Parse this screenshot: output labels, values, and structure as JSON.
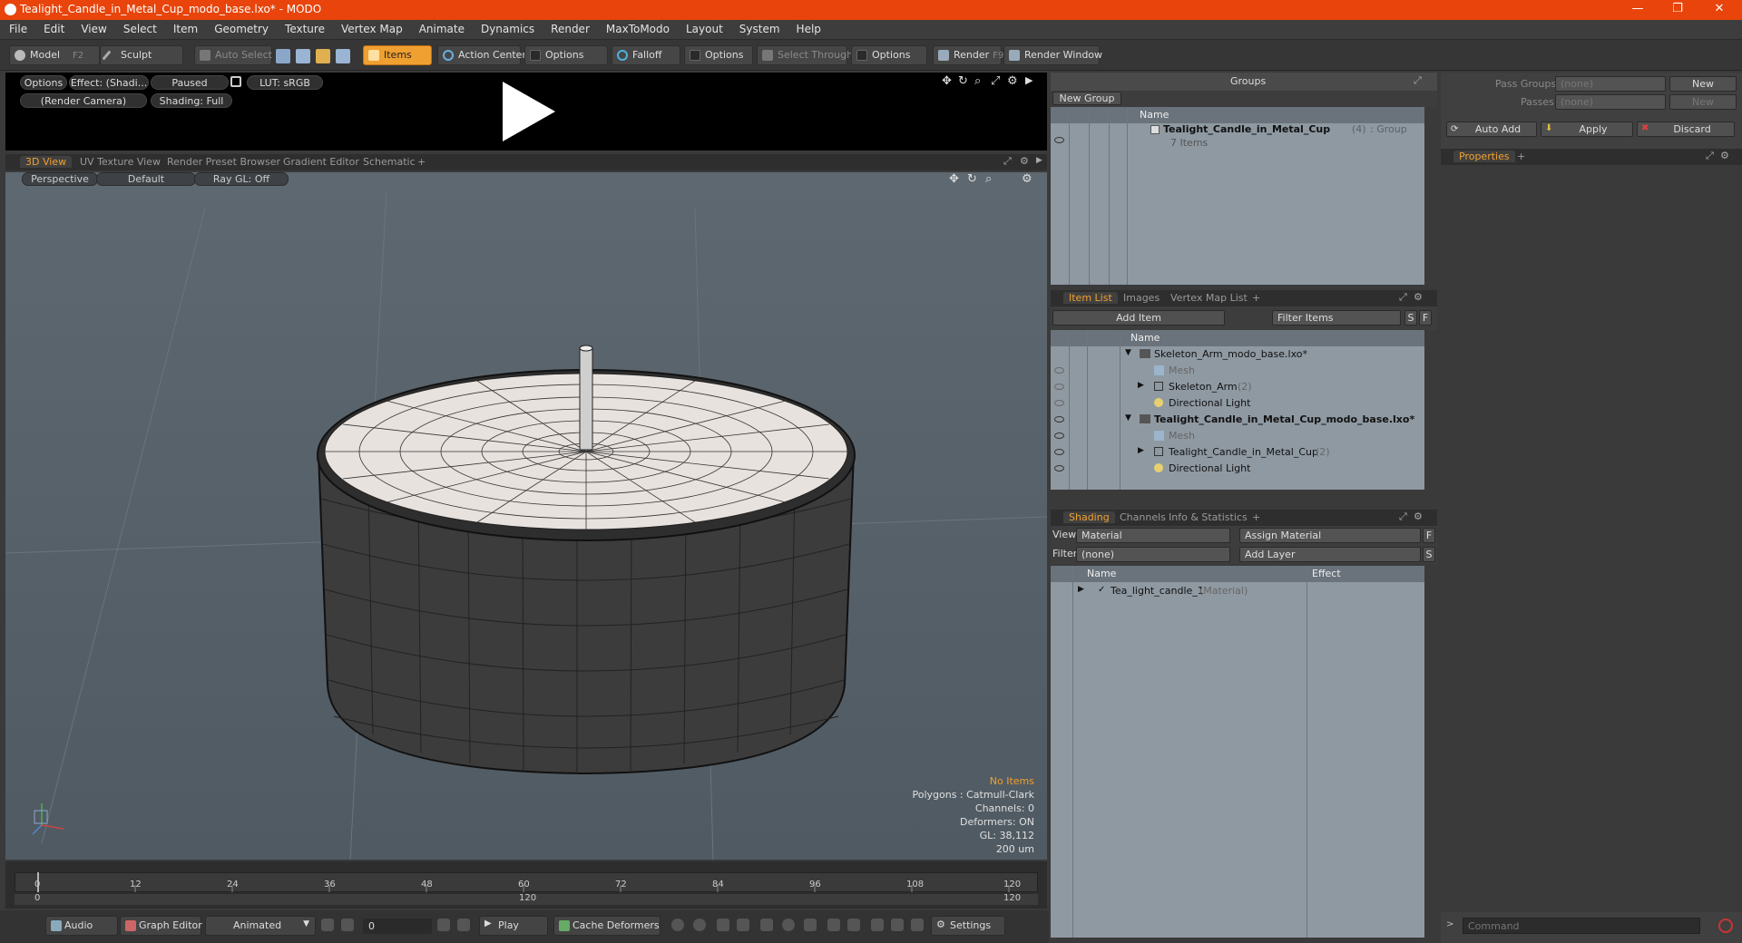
{
  "title_bar": {
    "title": "Tealight_Candle_in_Metal_Cup_modo_base.lxo* - MODO",
    "minimize": "—",
    "restore": "❐",
    "close": "✕"
  },
  "menu": [
    "File",
    "Edit",
    "View",
    "Select",
    "Item",
    "Geometry",
    "Texture",
    "Vertex Map",
    "Animate",
    "Dynamics",
    "Render",
    "MaxToModo",
    "Layout",
    "System",
    "Help"
  ],
  "toolbar": {
    "model": "Model",
    "model_key": "F2",
    "sculpt": "Sculpt",
    "auto_select": "Auto Select",
    "items": "Items",
    "action_center": "Action Center",
    "options1": "Options",
    "falloff": "Falloff",
    "options2": "Options",
    "select_through": "Select Through",
    "options3": "Options",
    "render": "Render",
    "render_key": "F9",
    "render_window": "Render Window"
  },
  "preview": {
    "options": "Options",
    "effect": "Effect: (Shadi...",
    "paused": "Paused",
    "lut": "LUT: sRGB",
    "camera": "(Render Camera)",
    "shading": "Shading: Full"
  },
  "view_tabs": [
    "3D View",
    "UV Texture View",
    "Render Preset Browser",
    "Gradient Editor",
    "Schematic",
    "+"
  ],
  "viewport": {
    "perspective": "Perspective",
    "default": "Default",
    "raygl": "Ray GL: Off",
    "stats": {
      "no_items": "No Items",
      "polygons": "Polygons : Catmull-Clark",
      "channels": "Channels: 0",
      "deformers": "Deformers: ON",
      "gl": "GL: 38,112",
      "scale": "200 um"
    }
  },
  "timeline": {
    "ticks": [
      "0",
      "12",
      "24",
      "36",
      "48",
      "60",
      "72",
      "84",
      "96",
      "108",
      "120"
    ],
    "lower_ticks": [
      "0",
      "120",
      "120"
    ]
  },
  "bottom_bar": {
    "audio": "Audio",
    "graph_editor": "Graph Editor",
    "animated": "Animated",
    "frame": "0",
    "play": "Play",
    "cache_deformers": "Cache Deformers",
    "settings": "Settings"
  },
  "groups_panel": {
    "title": "Groups",
    "new_group": "New Group",
    "col_name": "Name",
    "item_name": "Tealight_Candle_in_Metal_Cup",
    "item_count": "(4)",
    "item_type": ": Group",
    "item_sub": "7 Items"
  },
  "item_list": {
    "tabs": [
      "Item List",
      "Images",
      "Vertex Map List",
      "+"
    ],
    "add_item": "Add Item",
    "filter_items": "Filter Items",
    "s_btn": "S",
    "f_btn": "F",
    "col_name": "Name",
    "rows": [
      {
        "text": "Skeleton_Arm_modo_base.lxo*",
        "suffix": "",
        "bold": false,
        "dim": false
      },
      {
        "text": "Mesh",
        "suffix": "",
        "bold": false,
        "dim": true
      },
      {
        "text": "Skeleton_Arm",
        "suffix": "(2)",
        "bold": false,
        "dim": false
      },
      {
        "text": "Directional Light",
        "suffix": "",
        "bold": false,
        "dim": false
      },
      {
        "text": "Tealight_Candle_in_Metal_Cup_modo_base.lxo*",
        "suffix": "",
        "bold": true,
        "dim": false
      },
      {
        "text": "Mesh",
        "suffix": "",
        "bold": false,
        "dim": true
      },
      {
        "text": "Tealight_Candle_in_Metal_Cup",
        "suffix": "(2)",
        "bold": false,
        "dim": false
      },
      {
        "text": "Directional Light",
        "suffix": "",
        "bold": false,
        "dim": false
      }
    ]
  },
  "shading": {
    "tabs": [
      "Shading",
      "Channels",
      "Info & Statistics",
      "+"
    ],
    "view_label": "View",
    "view_value": "Material",
    "assign_material": "Assign Material",
    "f_btn": "F",
    "filter_label": "Filter",
    "filter_value": "(none)",
    "add_layer": "Add Layer",
    "s_btn": "S",
    "col_name": "Name",
    "col_effect": "Effect",
    "material_name": "Tea_light_candle_1",
    "material_type": "(Material)"
  },
  "right_panel": {
    "pass_groups": "Pass Groups",
    "pass_groups_value": "(none)",
    "passes": "Passes",
    "passes_value": "(none)",
    "new1": "New",
    "new2": "New",
    "auto_add": "Auto Add",
    "apply": "Apply",
    "discard": "Discard",
    "properties_tab": "Properties",
    "plus": "+",
    "command_placeholder": "Command"
  },
  "colors": {
    "accent": "#f0a030",
    "titlebar": "#e8440b",
    "panel_bg": "#8f99a2"
  }
}
